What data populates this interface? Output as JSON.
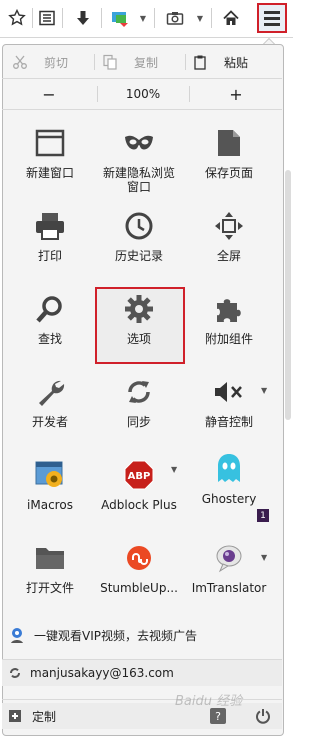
{
  "toolbar": {
    "icons": [
      "bookmark-star-icon",
      "reading-list-icon",
      "download-icon",
      "screenshot-tool-icon",
      "camera-icon",
      "home-icon",
      "hamburger-menu-icon"
    ]
  },
  "edit": {
    "cut_label": "剪切",
    "copy_label": "复制",
    "paste_label": "粘贴"
  },
  "zoom": {
    "minus": "−",
    "level": "100%",
    "plus": "+"
  },
  "grid": [
    {
      "label": "新建窗口"
    },
    {
      "label": "新建隐私浏览\n窗口"
    },
    {
      "label": "保存页面"
    },
    {
      "label": "打印"
    },
    {
      "label": "历史记录"
    },
    {
      "label": "全屏"
    },
    {
      "label": "查找"
    },
    {
      "label": "选项"
    },
    {
      "label": "附加组件"
    },
    {
      "label": "开发者"
    },
    {
      "label": "同步"
    },
    {
      "label": "静音控制"
    },
    {
      "label": "iMacros"
    },
    {
      "label": "Adblock Plus"
    },
    {
      "label": "Ghostery"
    },
    {
      "label": "打开文件"
    },
    {
      "label": "StumbleUp..."
    },
    {
      "label": "ImTranslator"
    }
  ],
  "ghostery_badge": "1",
  "adblock_icon_text": "ABP",
  "banner": {
    "text": "一键观看VIP视频，去视频广告"
  },
  "account": {
    "email": "manjusakayy@163.com"
  },
  "footer": {
    "customize_label": "定制"
  },
  "watermark": "Baidu 经验",
  "colors": {
    "highlight": "#d0202a",
    "panel_bg": "#f4f4f4",
    "icon_dark": "#444444"
  }
}
